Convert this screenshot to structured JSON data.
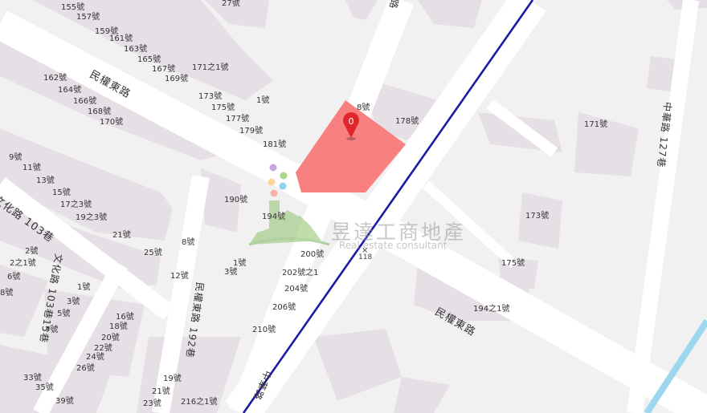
{
  "watermark": {
    "title": "昱達工商地產",
    "subtitle": "Real estate consultant"
  },
  "marker": {
    "label": "0",
    "color": "#e0262a"
  },
  "highlight_color": "#f98080",
  "rail_color": "#1a1aa8",
  "coordinate_marker": "118",
  "roads": [
    {
      "id": "minquan-upper",
      "text": "民權東路"
    },
    {
      "id": "minquan-lower",
      "text": "民權東路"
    },
    {
      "id": "wenhua-103",
      "text": "文化路 103巷"
    },
    {
      "id": "wenhua-103-15",
      "text": "文化路 103巷15巷"
    },
    {
      "id": "minquan-192",
      "text": "民權東路 192巷"
    },
    {
      "id": "zhonghua-127",
      "text": "中華路 127巷"
    },
    {
      "id": "zhonghua",
      "text": "中華路"
    },
    {
      "id": "top-road",
      "text": "路"
    }
  ],
  "addresses": [
    "155號",
    "157號",
    "159號",
    "161號",
    "163號",
    "165號",
    "167號",
    "169號",
    "171之1號",
    "27號",
    "162號",
    "164號",
    "166號",
    "168號",
    "170號",
    "173號",
    "175號",
    "177號",
    "179號",
    "181號",
    "1號",
    "8號",
    "178號",
    "171號",
    "9號",
    "11號",
    "13號",
    "15號",
    "17之3號",
    "19之3號",
    "21號",
    "25號",
    "8號",
    "12號",
    "190號",
    "194號",
    "173號",
    "175號",
    "194之1號",
    "200號",
    "202號之1",
    "204號",
    "206號",
    "210號",
    "1號",
    "3號",
    "2號",
    "2之1號",
    "6號",
    "8號",
    "1號",
    "3號",
    "5號",
    "7號",
    "16號",
    "18號",
    "20號",
    "22號",
    "24號",
    "26號",
    "33號",
    "35號",
    "39號",
    "19號",
    "21號",
    "23號",
    "216之1號"
  ]
}
